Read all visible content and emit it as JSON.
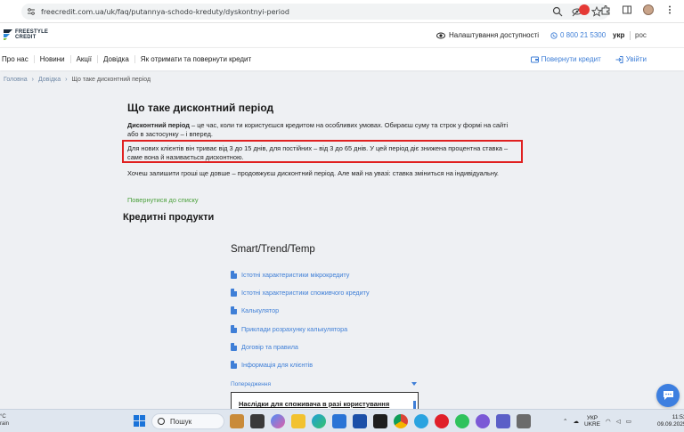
{
  "browser": {
    "url": "freecredit.com.ua/uk/faq/putannya-schodo-kreduty/dyskontnyi-period"
  },
  "header": {
    "logo_line1": "FREESTYLE",
    "logo_line2": "CREDIT",
    "accessibility": "Налаштування доступності",
    "phone": "0 800 21 5300",
    "lang_active": "укр",
    "lang_other": "рос"
  },
  "nav": {
    "items": [
      "Про нас",
      "Новини",
      "Акції",
      "Довідка",
      "Як отримати та повернути кредит"
    ],
    "repay": "Повернути кредит",
    "login": "Увійти"
  },
  "breadcrumb": {
    "home": "Головна",
    "section": "Довідка",
    "current": "Що таке дисконтний період"
  },
  "article": {
    "title": "Що таке дисконтний період",
    "term": "Дисконтний період",
    "p1_rest": " – це час, коли ти користуєшся кредитом на особливих умовах. Обираєш суму та строк у формі на сайті або в застосунку – і вперед.",
    "p2": "Для нових клієнтів він триває від 3 до 15 днів, для постійних – від 3 до 65 днів. У цей період діє знижена процентна ставка – саме вона й називається дисконтною.",
    "p3": "Хочеш залишити гроші ще довше – продовжуєш дисконтний період. Але май на увазі: ставка зміниться на індивідуальну.",
    "back_link": "Повернутися до списку"
  },
  "products": {
    "heading": "Кредитні продукти",
    "product_title": "Smart/Trend/Temp",
    "docs": [
      "Істотні характеристики мікрокредиту",
      "Істотні характеристики споживчого кредиту",
      "Калькулятор",
      "Приклади розрахунку калькулятора",
      "Договір та правила",
      "Інформація для клієнтів"
    ],
    "warning_label": "Попередження",
    "warning_box": "Наслідки для споживача в разі користування"
  },
  "taskbar": {
    "weather_line1": "°C",
    "weather_line2": "rain",
    "search": "Пошук",
    "lang_line1": "УКР",
    "lang_line2": "UKRE",
    "time": "11:53",
    "date": "09.09.2025"
  },
  "colors": {
    "link_blue": "#3f7fd7",
    "link_green": "#4aa03a",
    "highlight_red": "#e02020"
  }
}
